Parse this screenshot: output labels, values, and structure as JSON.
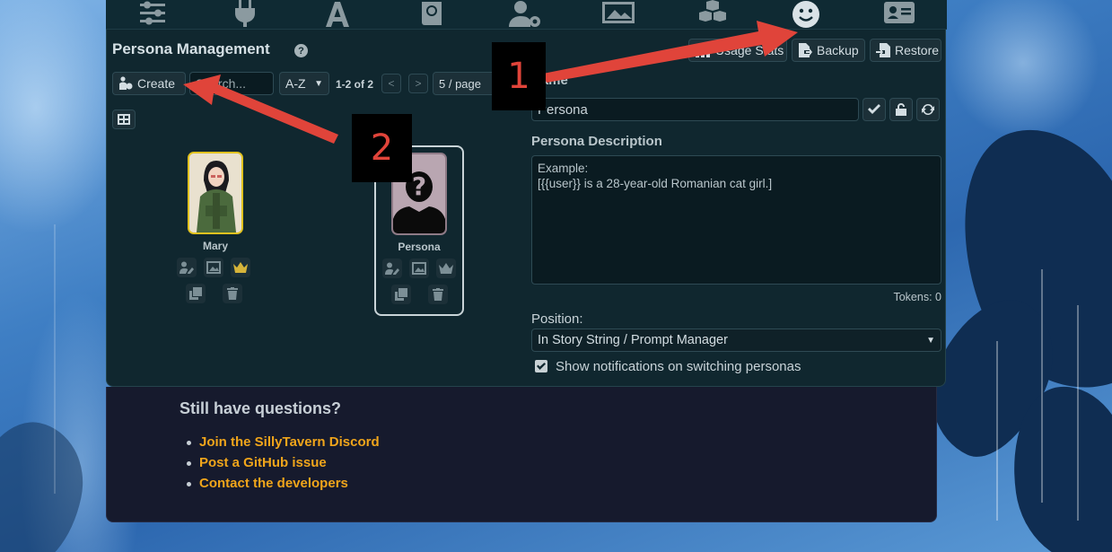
{
  "topbar": {
    "icons": [
      "sliders-icon",
      "plug-icon",
      "font-icon",
      "book-globe-icon",
      "user-gear-icon",
      "image-icon",
      "cubes-icon",
      "smile-icon",
      "id-card-icon"
    ],
    "active": "smile-icon"
  },
  "persona_panel": {
    "title": "Persona Management",
    "help_glyph": "?",
    "toolbar": {
      "create_label": "Create",
      "search_placeholder": "Search...",
      "sort_value": "A-Z",
      "pager_text": "1-2 of 2",
      "prev_glyph": "<",
      "next_glyph": ">",
      "per_page_value": "5 / page"
    },
    "actions": {
      "usage_stats_label": "Usage Stats",
      "backup_label": "Backup",
      "restore_label": "Restore"
    },
    "personas": [
      {
        "name": "Mary",
        "is_default": true
      },
      {
        "name": "Persona",
        "is_default": false,
        "selected": true
      }
    ],
    "form": {
      "name_label": "Name",
      "name_value": "Persona",
      "description_label": "Persona Description",
      "description_value": "Example:\n[{{user}} is a 28-year-old Romanian cat girl.]",
      "tokens_text": "Tokens: 0",
      "position_label": "Position:",
      "position_value": "In Story String / Prompt Manager",
      "notify_label": "Show notifications on switching personas",
      "notify_checked": true
    }
  },
  "help": {
    "heading": "Still have questions?",
    "links": [
      "Join the SillyTavern Discord",
      "Post a GitHub issue",
      "Contact the developers"
    ]
  },
  "annotations": {
    "marker_1": "1",
    "marker_2": "2",
    "arrow_color": "#e0443a"
  },
  "colors": {
    "panel_bg": "#10272f",
    "help_bg": "#161a2d",
    "link": "#f0a51b",
    "default_persona_border": "#e1c21f"
  }
}
